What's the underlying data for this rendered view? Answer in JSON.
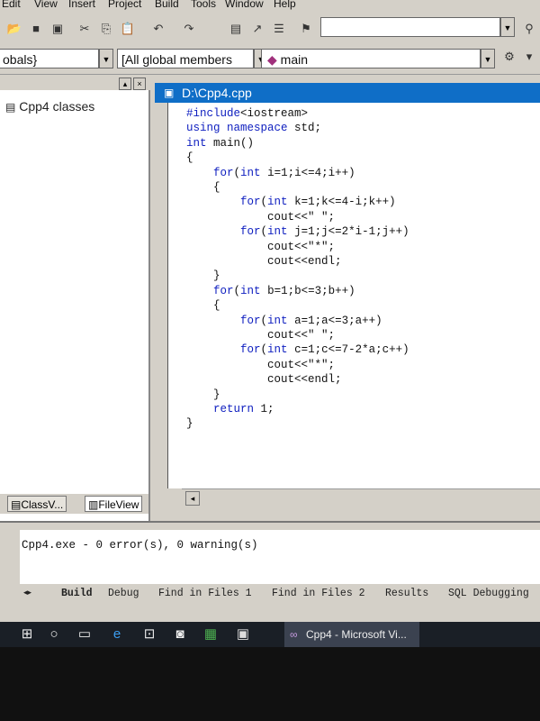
{
  "menubar": {
    "items": [
      "Edit",
      "View",
      "Insert",
      "Project",
      "Build",
      "Tools",
      "Window",
      "Help"
    ]
  },
  "toolbar": {
    "icons": [
      "open-icon",
      "save-icon",
      "save-all-icon",
      "cut-icon",
      "copy-icon",
      "paste-icon",
      "undo-icon",
      "redo-icon",
      "workspace-icon",
      "output-icon",
      "find-in-files-icon"
    ],
    "find_combo_value": ""
  },
  "wizardbar": {
    "scope_combo": "obals}",
    "members_combo": "[All global members",
    "function_combo": "main"
  },
  "workspace": {
    "root_label": "Cpp4 classes",
    "tabs": [
      "ClassV...",
      "FileView"
    ]
  },
  "editor": {
    "title": "D:\\Cpp4.cpp",
    "lines": [
      "#include<iostream>",
      "using namespace std;",
      "int main()",
      "{",
      "    for(int i=1;i<=4;i++)",
      "    {",
      "        for(int k=1;k<=4-i;k++)",
      "            cout<<\" \";",
      "        for(int j=1;j<=2*i-1;j++)",
      "            cout<<\"*\";",
      "            cout<<endl;",
      "    }",
      "    for(int b=1;b<=3;b++)",
      "    {",
      "        for(int a=1;a<=3;a++)",
      "            cout<<\" \";",
      "        for(int c=1;c<=7-2*a;c++)",
      "            cout<<\"*\";",
      "            cout<<endl;",
      "    }",
      "    return 1;",
      "}"
    ]
  },
  "output": {
    "message": "Cpp4.exe - 0 error(s), 0 warning(s)",
    "tabs": [
      "Build",
      "Debug",
      "Find in Files 1",
      "Find in Files 2",
      "Results",
      "SQL Debugging"
    ]
  },
  "taskbar": {
    "icons": [
      "windows-start-icon",
      "search-icon",
      "task-view-icon",
      "edge-icon",
      "store-icon",
      "app-icon",
      "excel-icon",
      "file-explorer-icon"
    ],
    "active_app": "Cpp4 - Microsoft Vi..."
  },
  "colors": {
    "title_bar": "#0f6ec7",
    "keyword": "#1020c0",
    "taskbar": "#1a1f26"
  }
}
